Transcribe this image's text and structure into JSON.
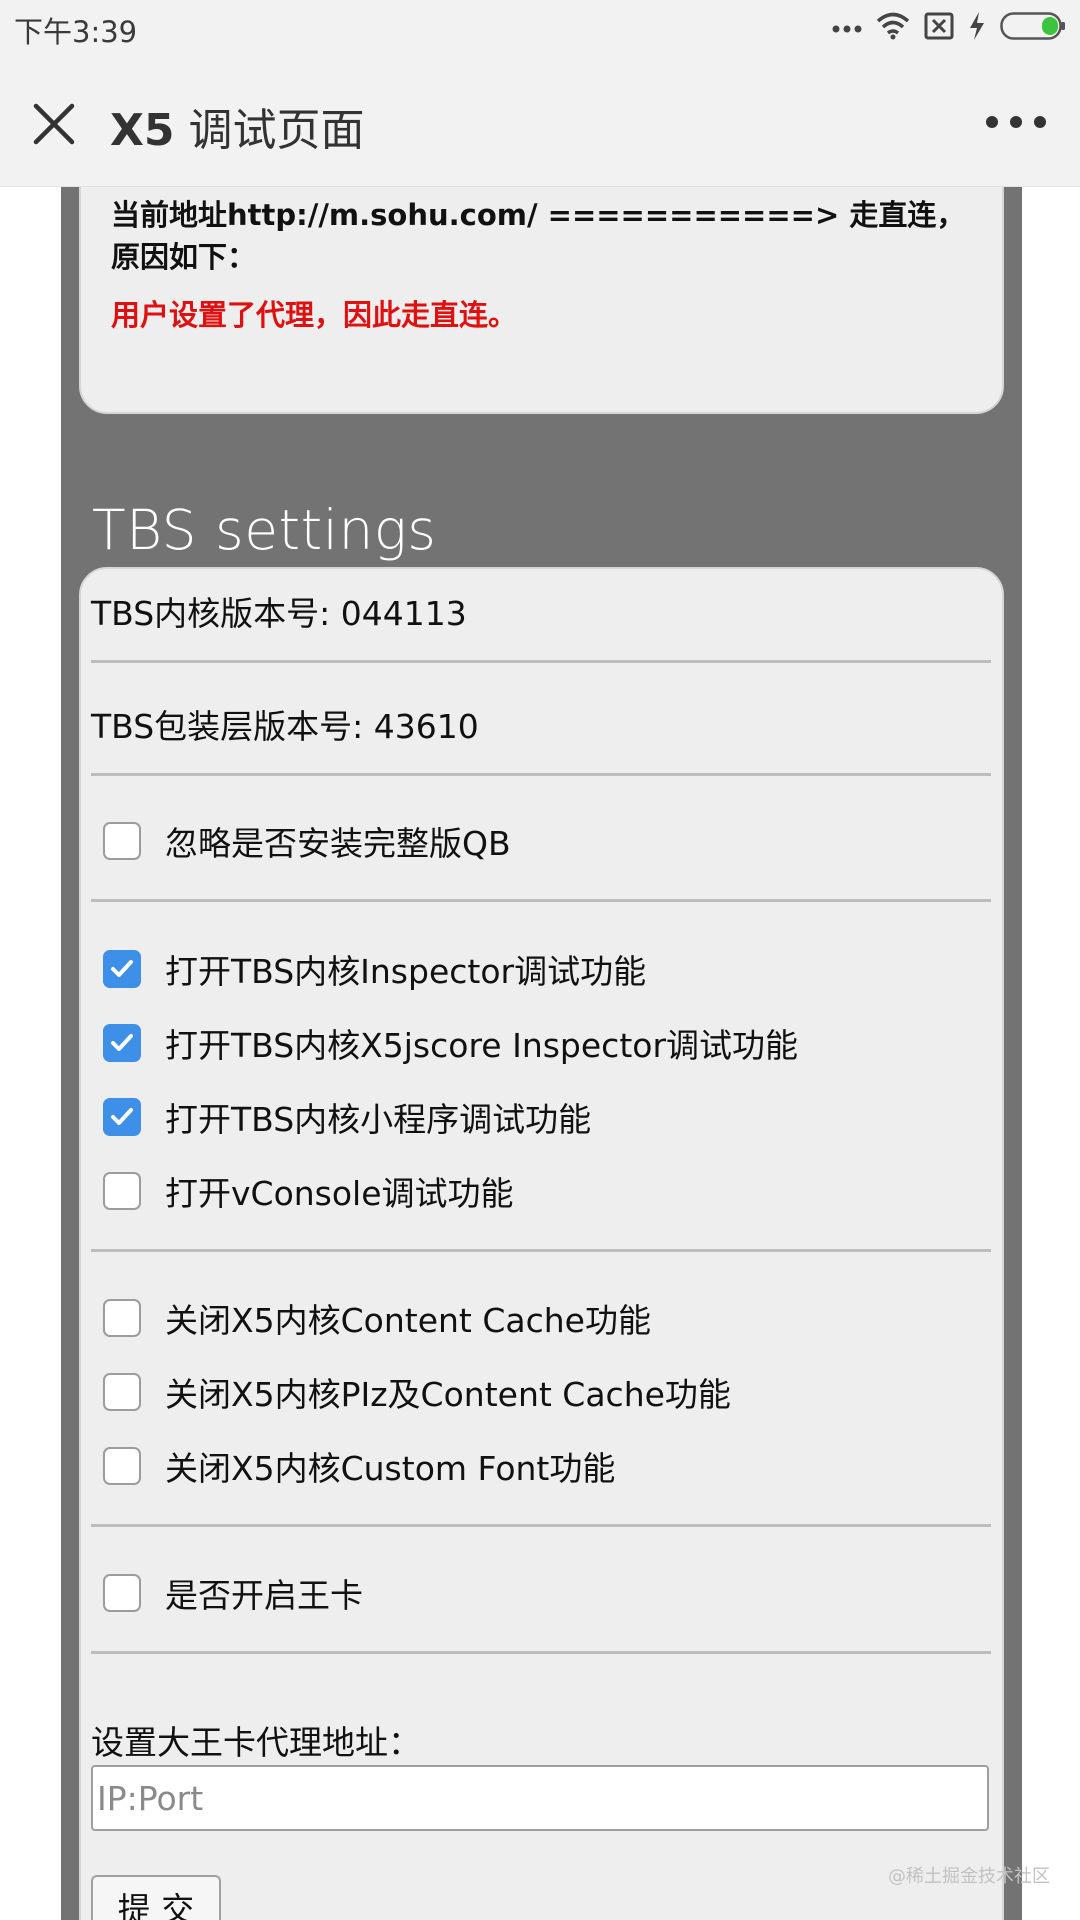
{
  "status_bar": {
    "time": "下午3:39",
    "icons": [
      "more-dots-icon",
      "wifi-icon",
      "sim-x-icon",
      "charging-bolt-icon",
      "battery-icon"
    ],
    "battery_color": "#3cc53c"
  },
  "title_bar": {
    "title_prefix": "X5",
    "title_suffix": " 调试页面",
    "close_icon": "close-icon",
    "more_icon": "more-icon"
  },
  "proxy_info": {
    "line": "当前地址http://m.sohu.com/ ===========> 走直连，原因如下：",
    "reason": "用户设置了代理，因此走直连。",
    "reason_color": "#e01010"
  },
  "tbs": {
    "section_title": "TBS settings",
    "core_version": "TBS内核版本号: 044113",
    "wrapper_version": "TBS包装层版本号: 43610",
    "options": [
      {
        "label": "忽略是否安装完整版QB",
        "checked": false
      },
      {
        "label": "打开TBS内核Inspector调试功能",
        "checked": true
      },
      {
        "label": "打开TBS内核X5jscore Inspector调试功能",
        "checked": true
      },
      {
        "label": "打开TBS内核小程序调试功能",
        "checked": true
      },
      {
        "label": "打开vConsole调试功能",
        "checked": false
      },
      {
        "label": "关闭X5内核Content Cache功能",
        "checked": false
      },
      {
        "label": "关闭X5内核PIz及Content Cache功能",
        "checked": false
      },
      {
        "label": "关闭X5内核Custom Font功能",
        "checked": false
      },
      {
        "label": "是否开启王卡",
        "checked": false
      }
    ],
    "proxy_label": "设置大王卡代理地址：",
    "proxy_placeholder": "IP:Port",
    "proxy_value": "",
    "submit_label": "提 交"
  },
  "colors": {
    "checkbox_checked": "#3d8fe8",
    "page_bg": "#737373",
    "panel_bg": "#eeeeee"
  },
  "watermark": "@稀土掘金技术社区"
}
